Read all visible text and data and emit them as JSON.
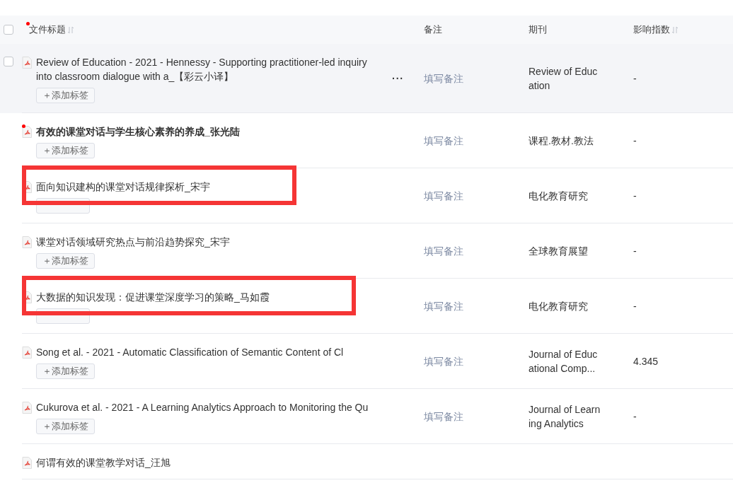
{
  "header": {
    "checked": false,
    "columns": [
      {
        "label": "文件标题",
        "dot": true,
        "sortable": true
      },
      {
        "label": "备注",
        "dot": false,
        "sortable": false
      },
      {
        "label": "期刊",
        "dot": false,
        "sortable": false
      },
      {
        "label": "影响指数",
        "dot": false,
        "sortable": true
      }
    ]
  },
  "rows": [
    {
      "title": "Review of Education - 2021 - Hennessy - Supporting practitioner-led inquiry into classroom dialogue with a_【彩云小译】",
      "hovered": true,
      "checked": false,
      "more": "···",
      "unread": false,
      "highlighted": false,
      "tag_button": "＋添加标签",
      "note": "填写备注",
      "journal": "Review of Education",
      "impact": "-"
    },
    {
      "title": "有效的课堂对话与学生核心素养的养成_张光陆",
      "unread": true,
      "highlighted": false,
      "tag_button": "＋添加标签",
      "note": "填写备注",
      "journal": "课程.教材.教法",
      "impact": "-"
    },
    {
      "title": "面向知识建构的课堂对话规律探析_宋宇",
      "unread": false,
      "highlighted": true,
      "note": "填写备注",
      "journal": "电化教育研究",
      "impact": "-"
    },
    {
      "title": "课堂对话领域研究热点与前沿趋势探究_宋宇",
      "unread": false,
      "highlighted": false,
      "tag_button": "＋添加标签",
      "note": "填写备注",
      "journal": "全球教育展望",
      "impact": "-"
    },
    {
      "title": "大数据的知识发现：促进课堂深度学习的策略_马如霞",
      "unread": false,
      "highlighted": true,
      "note": "填写备注",
      "journal": "电化教育研究",
      "impact": "-"
    },
    {
      "title": "Song et al. - 2021 - Automatic Classification of Semantic Content of Cl",
      "unread": false,
      "highlighted": false,
      "tag_button": "＋添加标签",
      "note": "填写备注",
      "journal": "Journal of Educational Comp...",
      "impact": "4.345"
    },
    {
      "title": "Cukurova et al. - 2021 - A Learning Analytics Approach to Monitoring the Qu",
      "unread": false,
      "highlighted": false,
      "tag_button": "＋添加标签",
      "note": "填写备注",
      "journal": "Journal of Learning Analytics",
      "impact": "-"
    },
    {
      "title": "何谓有效的课堂教学对话_汪旭",
      "unread": false,
      "highlighted": false
    }
  ]
}
